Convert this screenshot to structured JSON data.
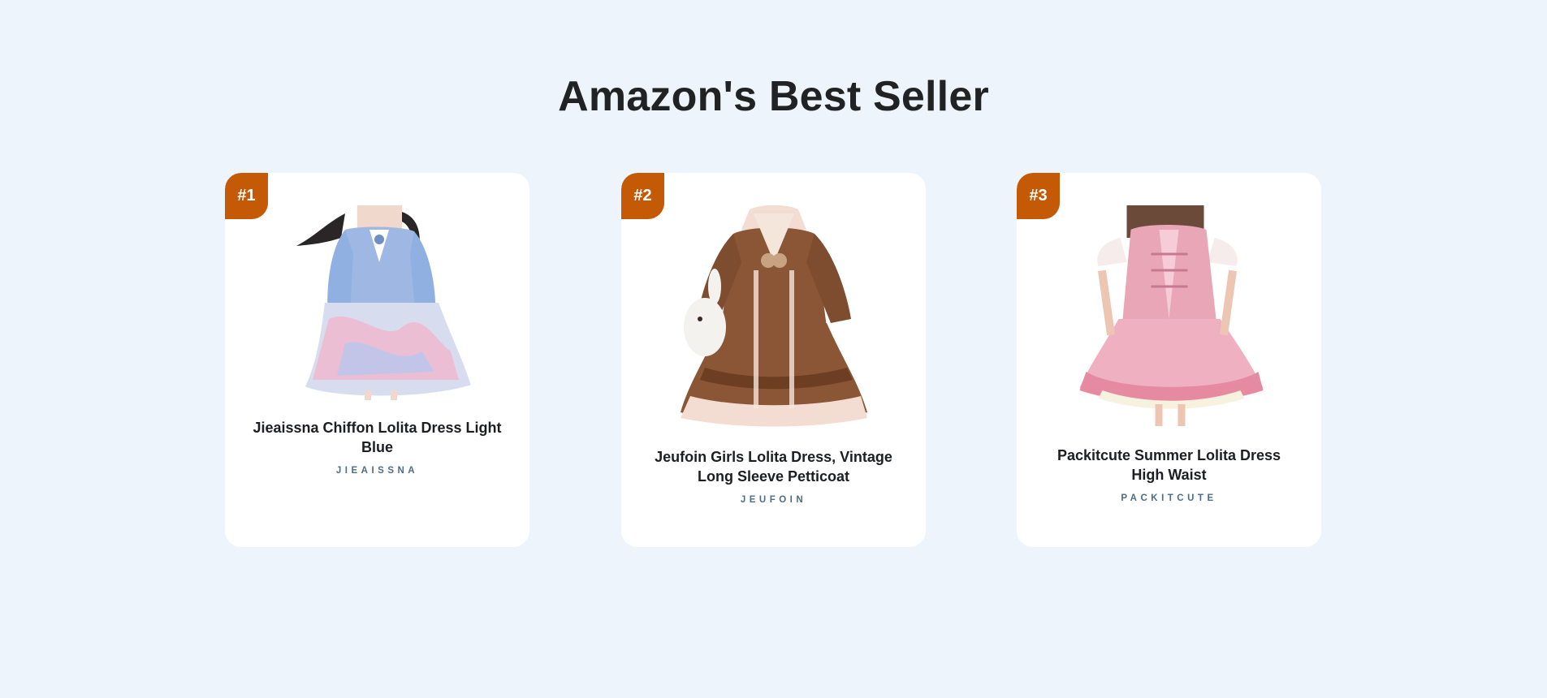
{
  "page": {
    "title": "Amazon's Best Seller",
    "background_color": "#edf4fc"
  },
  "badge_color": "#c45a06",
  "products": [
    {
      "rank": "#1",
      "name": "Jieaissna Chiffon Lolita Dress Light Blue",
      "brand": "JIEAISSNA",
      "image": "light-blue-lolita-dress"
    },
    {
      "rank": "#2",
      "name": "Jeufoin Girls Lolita Dress, Vintage Long Sleeve Petticoat",
      "brand": "JEUFOIN",
      "image": "brown-lolita-dress"
    },
    {
      "rank": "#3",
      "name": "Packitcute Summer Lolita Dress High Waist",
      "brand": "PACKITCUTE",
      "image": "pink-lolita-dress"
    }
  ]
}
